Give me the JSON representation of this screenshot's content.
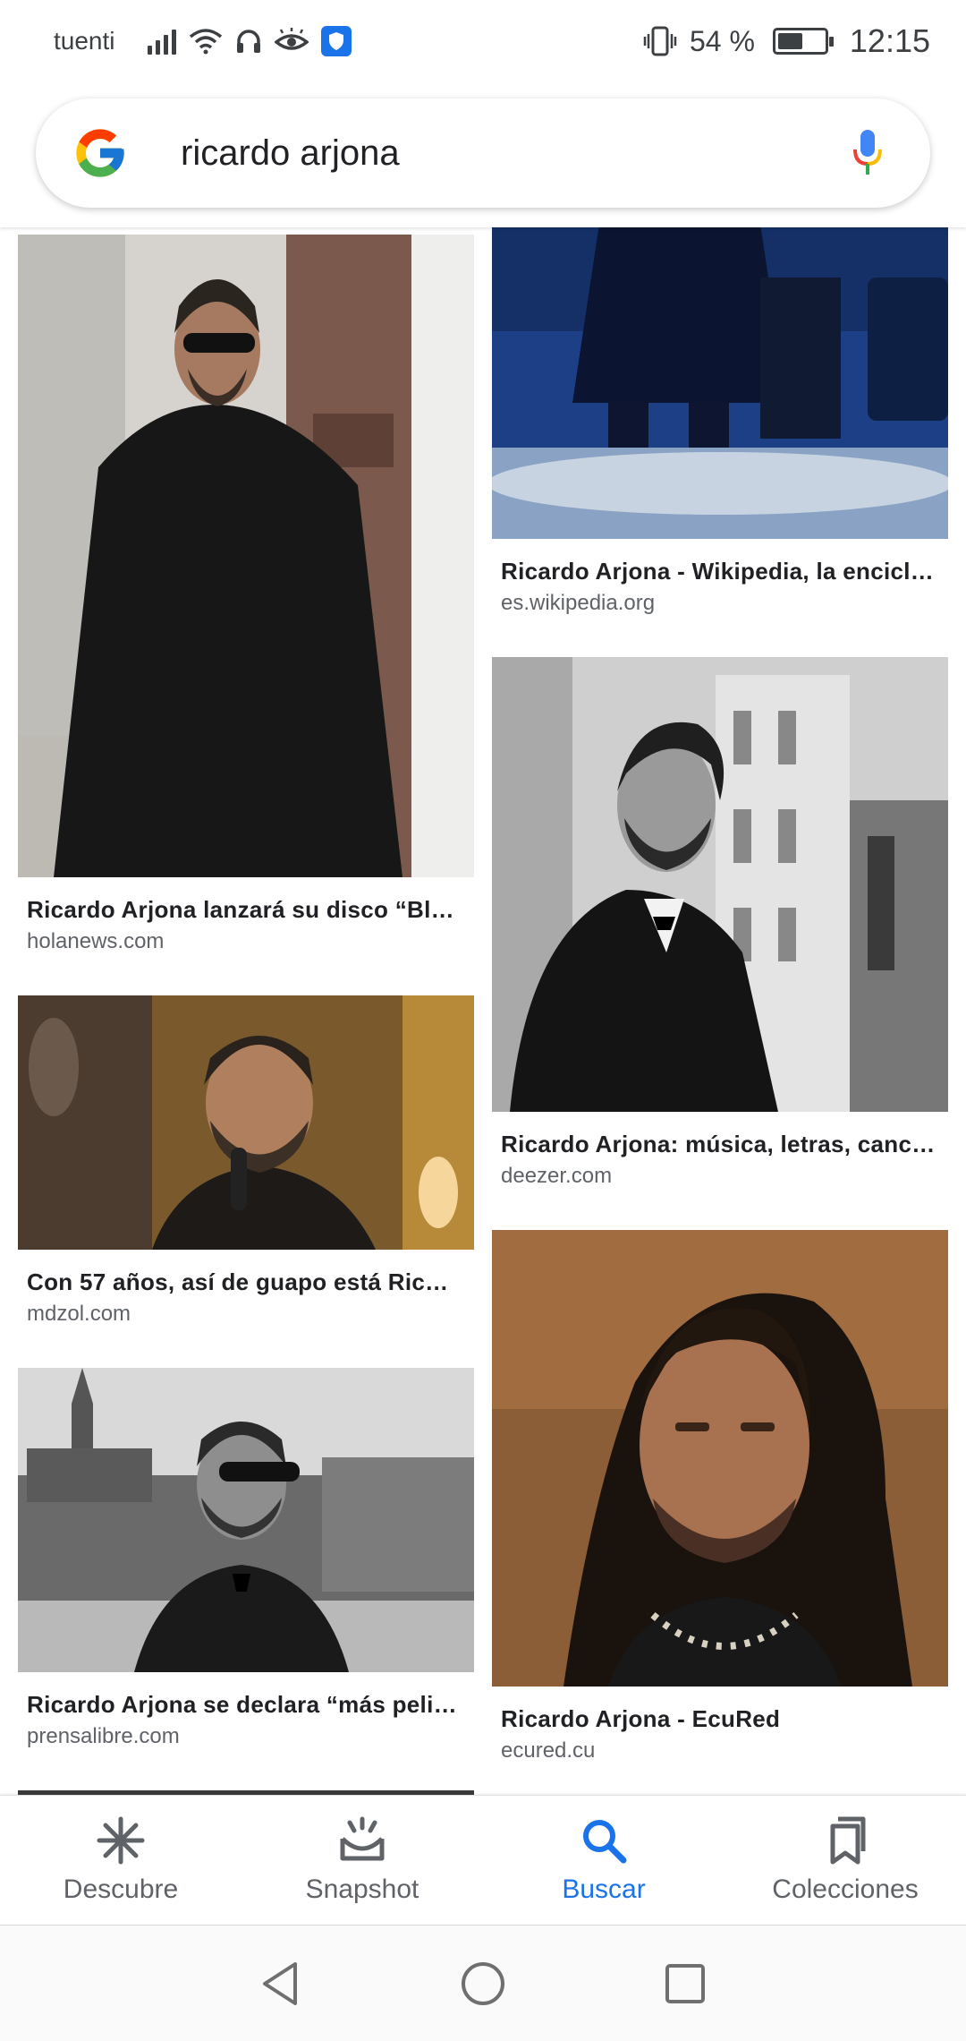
{
  "status_bar": {
    "carrier": "tuenti",
    "battery_percent_text": "54 %",
    "battery_level": 0.54,
    "time": "12:15"
  },
  "search": {
    "query": "ricardo arjona",
    "placeholder": "ricardo arjona"
  },
  "results": [
    {
      "title": "Ricardo Arjona lanzará su disco “Bl…",
      "source": "holanews.com"
    },
    {
      "title": "Ricardo Arjona - Wikipedia, la encicl…",
      "source": "es.wikipedia.org"
    },
    {
      "title": "Con 57 años, así de guapo está Ric…",
      "source": "mdzol.com"
    },
    {
      "title": "Ricardo Arjona: música, letras, canc…",
      "source": "deezer.com"
    },
    {
      "title": "Ricardo Arjona se declara “más peli…",
      "source": "prensalibre.com"
    },
    {
      "title": "Ricardo Arjona - EcuRed",
      "source": "ecured.cu"
    }
  ],
  "bottom_nav": [
    {
      "label": "Descubre",
      "icon": "asterisk-icon",
      "active": false
    },
    {
      "label": "Snapshot",
      "icon": "snapshot-icon",
      "active": false
    },
    {
      "label": "Buscar",
      "icon": "search-icon",
      "active": true
    },
    {
      "label": "Colecciones",
      "icon": "bookmarks-icon",
      "active": false
    }
  ],
  "colors": {
    "accent": "#1a73e8",
    "text_primary": "#202124",
    "text_secondary": "#5f6368"
  }
}
